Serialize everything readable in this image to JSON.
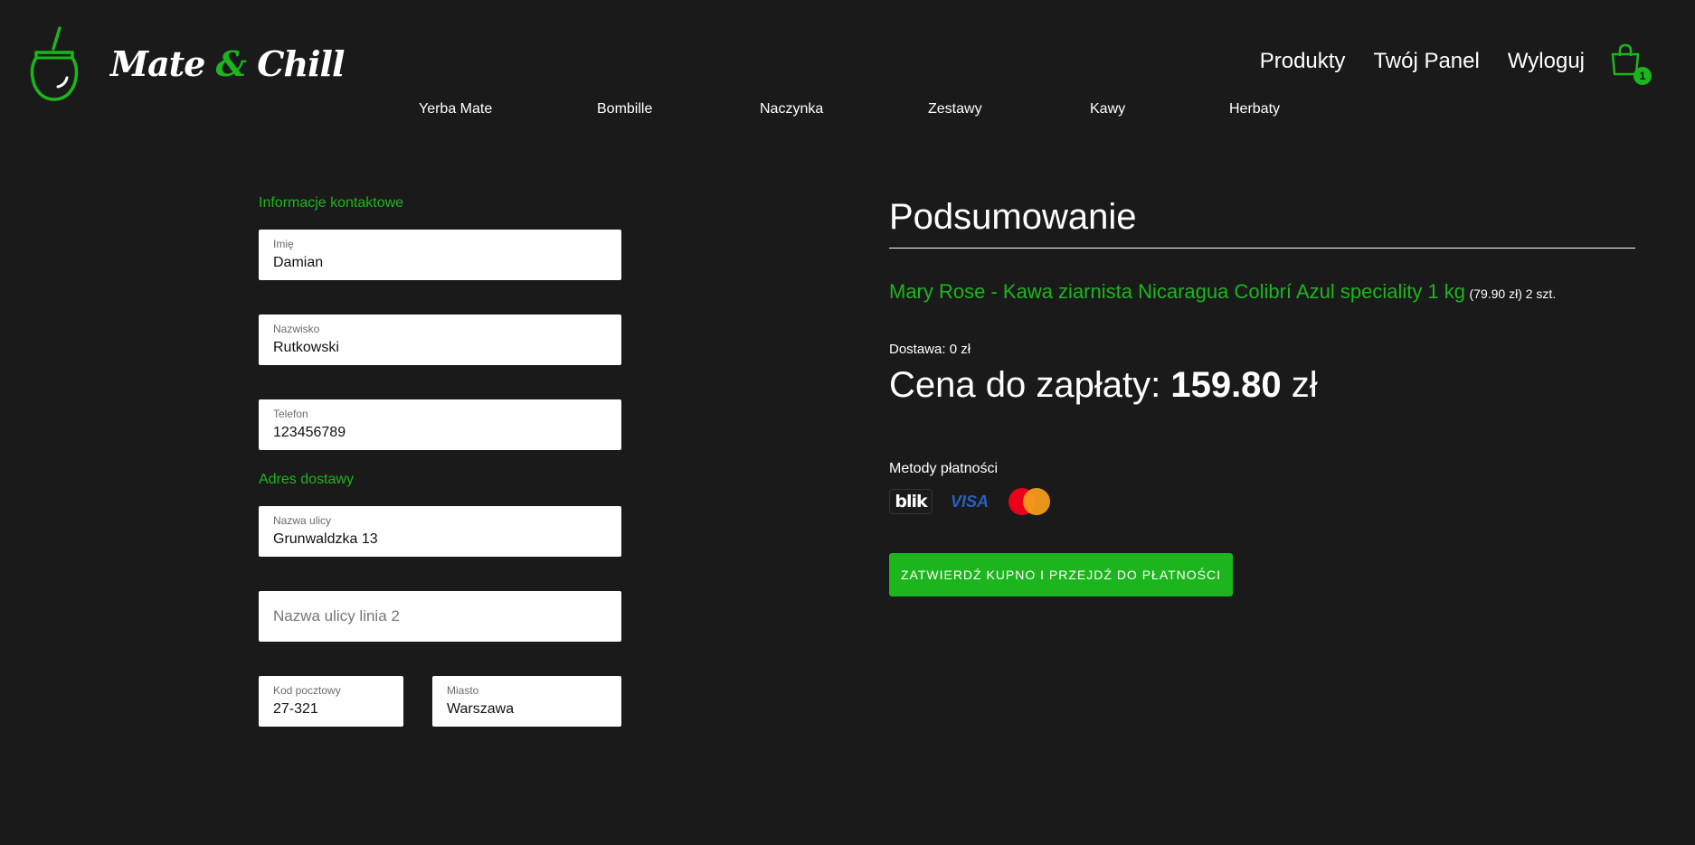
{
  "brand": {
    "name_left": "Mate",
    "name_amp": "&",
    "name_right": "Chill"
  },
  "top_nav": {
    "products": "Produkty",
    "panel": "Twój Panel",
    "logout": "Wyloguj",
    "cart_count": "1"
  },
  "categories": [
    "Yerba Mate",
    "Bombille",
    "Naczynka",
    "Zestawy",
    "Kawy",
    "Herbaty"
  ],
  "form": {
    "contact_title": "Informacje kontaktowe",
    "first_name": {
      "label": "Imię",
      "value": "Damian"
    },
    "last_name": {
      "label": "Nazwisko",
      "value": "Rutkowski"
    },
    "phone": {
      "label": "Telefon",
      "value": "123456789"
    },
    "address_title": "Adres dostawy",
    "street": {
      "label": "Nazwa ulicy",
      "value": "Grunwaldzka 13"
    },
    "street2": {
      "placeholder": "Nazwa ulicy linia 2"
    },
    "postal": {
      "label": "Kod pocztowy",
      "value": "27-321"
    },
    "city": {
      "label": "Miasto",
      "value": "Warszawa"
    }
  },
  "summary": {
    "title": "Podsumowanie",
    "product_name": "Mary Rose - Kawa ziarnista Nicaragua Colibrí Azul speciality 1 kg",
    "product_meta": "(79.90 zł) 2 szt.",
    "delivery": "Dostawa: 0 zł",
    "price_label": "Cena do zapłaty:",
    "price_value": "159.80",
    "price_currency": "zł",
    "pay_methods_label": "Metody płatności",
    "blik": "blik",
    "visa": "VISA",
    "confirm_button": "Zatwierdź kupno i przejdź do płatności"
  },
  "colors": {
    "accent": "#1db51d",
    "background": "#1a1a1a"
  }
}
